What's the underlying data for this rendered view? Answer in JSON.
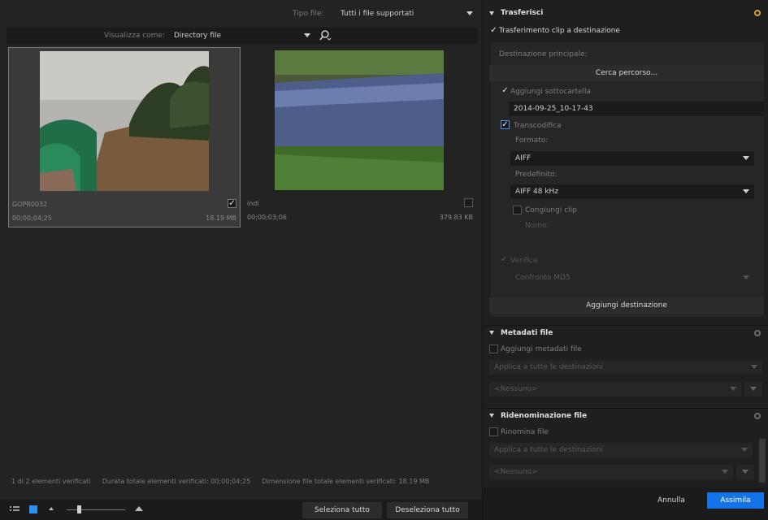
{
  "filter": {
    "tipo_label": "Tipo file:",
    "tipo_value": "Tutti i file supportati",
    "view_label": "Visualizza come:",
    "view_value": "Directory file"
  },
  "clips": [
    {
      "name": "GOPR0032",
      "duration": "00;00;04;25",
      "size": "18.19 MB"
    },
    {
      "name": "indi",
      "duration": "00;00;03;06",
      "size": "379.83 KB"
    }
  ],
  "status": {
    "count": "1 di 2 elementi verificati",
    "duration": "Durata totale elementi verificati: 00;00;04;25",
    "size": "Dimensione file totale elementi verificati: 18.19 MB"
  },
  "footer": {
    "select_all": "Seleziona tutto",
    "deselect_all": "Deseleziona tutto",
    "cancel": "Annulla",
    "ingest": "Assimila"
  },
  "transfer": {
    "title": "Trasferisci",
    "clip_transfer": "Trasferimento clip a destinazione",
    "main_dest": "Destinazione principale:",
    "browse": "Cerca percorso...",
    "add_subfolder": "Aggiungi sottocartella",
    "subfolder_value": "2014-09-25_10-17-43",
    "transcode": "Transcodifica",
    "format_label": "Formato:",
    "format_value": "AIFF",
    "preset_label": "Predefinito:",
    "preset_value": "AIFF 48 kHz",
    "join_clips": "Congiungi clip",
    "name_label": "Nome:",
    "verify": "Verifica",
    "verify_value": "Confronto MD5",
    "add_dest": "Aggiungi destinazione"
  },
  "metadata": {
    "title": "Metadati file",
    "add": "Aggiungi metadati file",
    "apply": "Applica a tutte le destinazioni",
    "none": "<Nessuno>"
  },
  "rename": {
    "title": "Ridenominazione file",
    "rename": "Rinomina file",
    "apply": "Applica a tutte le destinazioni",
    "none": "<Nessuno>"
  },
  "colors": {
    "accent": "#1473e6",
    "gear_active": "#d9a421"
  }
}
